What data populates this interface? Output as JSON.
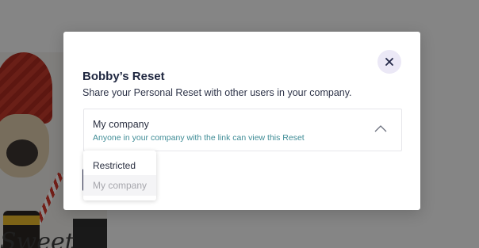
{
  "background": {
    "image_text": "Sweet"
  },
  "modal": {
    "title": "Bobby’s Reset",
    "subtitle": "Share your Personal Reset with other users in your company.",
    "close_icon": "close-icon",
    "access_select": {
      "value": "My company",
      "description": "Anyone in your company with the link can view this Reset",
      "chevron_icon": "chevron-up-icon",
      "expanded": true
    },
    "dropdown": {
      "options": [
        "Restricted",
        "My company"
      ],
      "selected": "My company"
    }
  },
  "colors": {
    "title": "#1f2740",
    "description": "#3f8c96",
    "close_bg": "#ebe8f6",
    "primary": "#232747"
  }
}
